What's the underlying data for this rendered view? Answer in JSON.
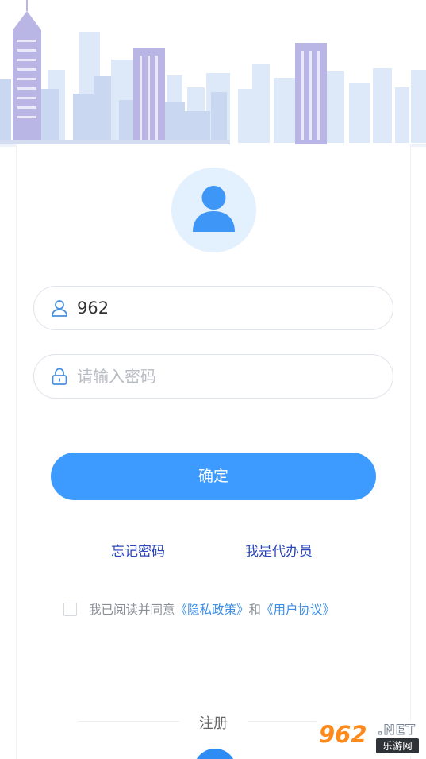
{
  "login": {
    "username_value": "962",
    "password_placeholder": "请输入密码",
    "confirm_label": "确定",
    "forgot_password": "忘记密码",
    "agent_link": "我是代办员"
  },
  "agreement": {
    "prefix": "我已阅读并同意",
    "privacy_link": "《隐私政策》",
    "conjunction": "和",
    "user_link": "《用户协议》",
    "checked": false
  },
  "register": {
    "label": "注册"
  },
  "watermark": {
    "number": "962",
    "suffix": ".NET",
    "site_name": "乐游网"
  },
  "icons": [
    "city-skyline",
    "avatar-icon",
    "user-icon",
    "lock-icon",
    "register-icon"
  ],
  "colors": {
    "primary": "#3d9bff",
    "link": "#2a46b8",
    "agreement_link": "#3d8ee6",
    "avatar_bg": "#e3f0fe",
    "avatar_fg": "#3e96f7"
  }
}
